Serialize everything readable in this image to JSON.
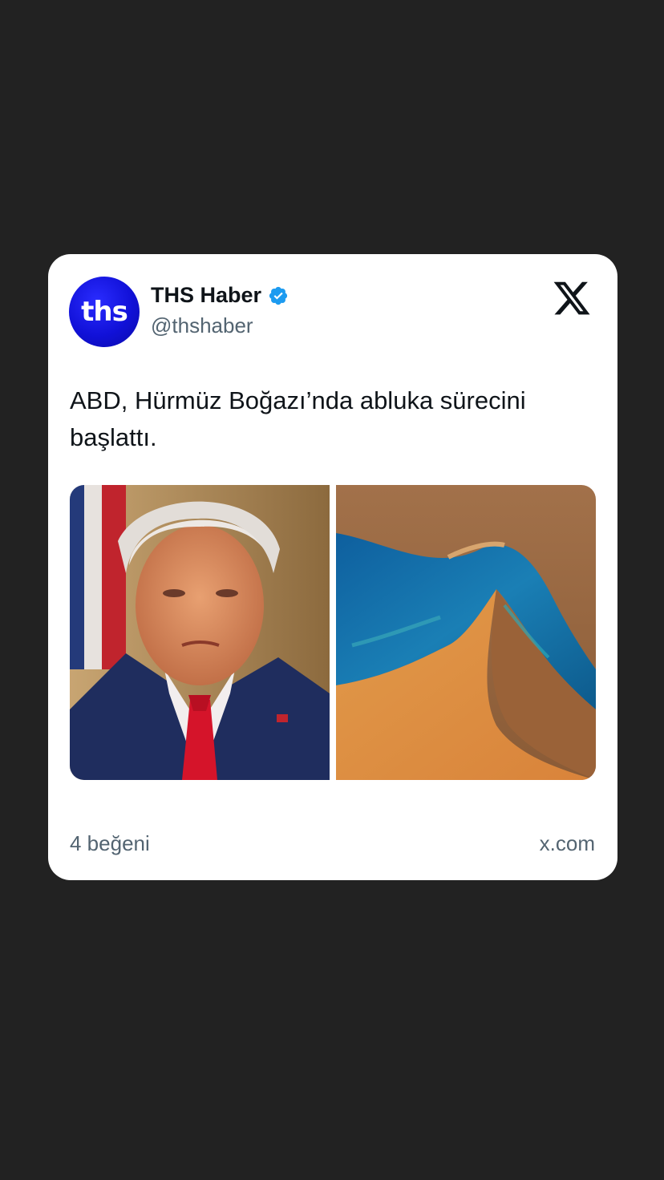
{
  "account": {
    "avatar_text": "ths",
    "display_name": "THS Haber",
    "handle": "@thshaber",
    "verified": true
  },
  "tweet": {
    "text": "ABD, Hürmüz Boğazı’nda abluka sürecini başlattı."
  },
  "media": [
    {
      "icon": "portrait-photo"
    },
    {
      "icon": "satellite-strait-photo"
    }
  ],
  "footer": {
    "likes": "4 beğeni",
    "source": "x.com"
  },
  "colors": {
    "background": "#222222",
    "card": "#ffffff",
    "text_primary": "#0f1419",
    "text_secondary": "#536471",
    "verified": "#1d9bf0",
    "avatar": "#1414e0"
  }
}
